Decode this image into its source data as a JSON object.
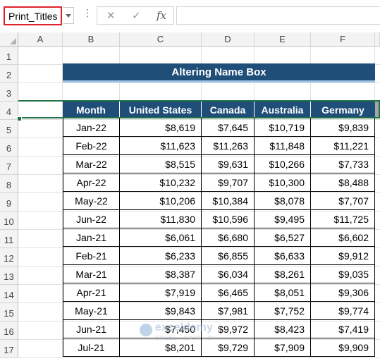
{
  "formula_bar": {
    "name_box_value": "Print_Titles",
    "more_icon": "⋮",
    "cancel_icon": "✕",
    "enter_icon": "✓",
    "fx_icon": "fx",
    "formula_value": ""
  },
  "columns": [
    "A",
    "B",
    "C",
    "D",
    "E",
    "F"
  ],
  "rows": [
    "1",
    "2",
    "3",
    "4",
    "5",
    "6",
    "7",
    "8",
    "9",
    "10",
    "11",
    "12",
    "13",
    "14",
    "15",
    "16",
    "17"
  ],
  "title": "Altering Name Box",
  "table": {
    "headers": [
      "Month",
      "United States",
      "Canada",
      "Australia",
      "Germany"
    ],
    "rows": [
      [
        "Jan-22",
        "$8,619",
        "$7,645",
        "$10,719",
        "$9,839"
      ],
      [
        "Feb-22",
        "$11,623",
        "$11,263",
        "$11,848",
        "$11,221"
      ],
      [
        "Mar-22",
        "$8,515",
        "$9,631",
        "$10,266",
        "$7,733"
      ],
      [
        "Apr-22",
        "$10,232",
        "$9,707",
        "$10,300",
        "$8,488"
      ],
      [
        "May-22",
        "$10,206",
        "$10,384",
        "$8,078",
        "$7,707"
      ],
      [
        "Jun-22",
        "$11,830",
        "$10,596",
        "$9,495",
        "$11,725"
      ],
      [
        "Jan-21",
        "$6,061",
        "$6,680",
        "$6,527",
        "$6,602"
      ],
      [
        "Feb-21",
        "$6,233",
        "$6,855",
        "$6,633",
        "$9,912"
      ],
      [
        "Mar-21",
        "$8,387",
        "$6,034",
        "$8,261",
        "$9,035"
      ],
      [
        "Apr-21",
        "$7,919",
        "$6,465",
        "$8,051",
        "$9,306"
      ],
      [
        "May-21",
        "$9,843",
        "$7,981",
        "$7,752",
        "$9,774"
      ],
      [
        "Jun-21",
        "$7,450",
        "$9,972",
        "$8,423",
        "$7,419"
      ],
      [
        "Jul-21",
        "$8,201",
        "$9,729",
        "$7,909",
        "$9,909"
      ]
    ]
  },
  "watermark": {
    "brand": "exceldemy",
    "tagline": "EXCEL · DATA · BI"
  },
  "colors": {
    "header_fill": "#1f4e79",
    "selection": "#217346",
    "name_box_border": "#e0202a"
  }
}
